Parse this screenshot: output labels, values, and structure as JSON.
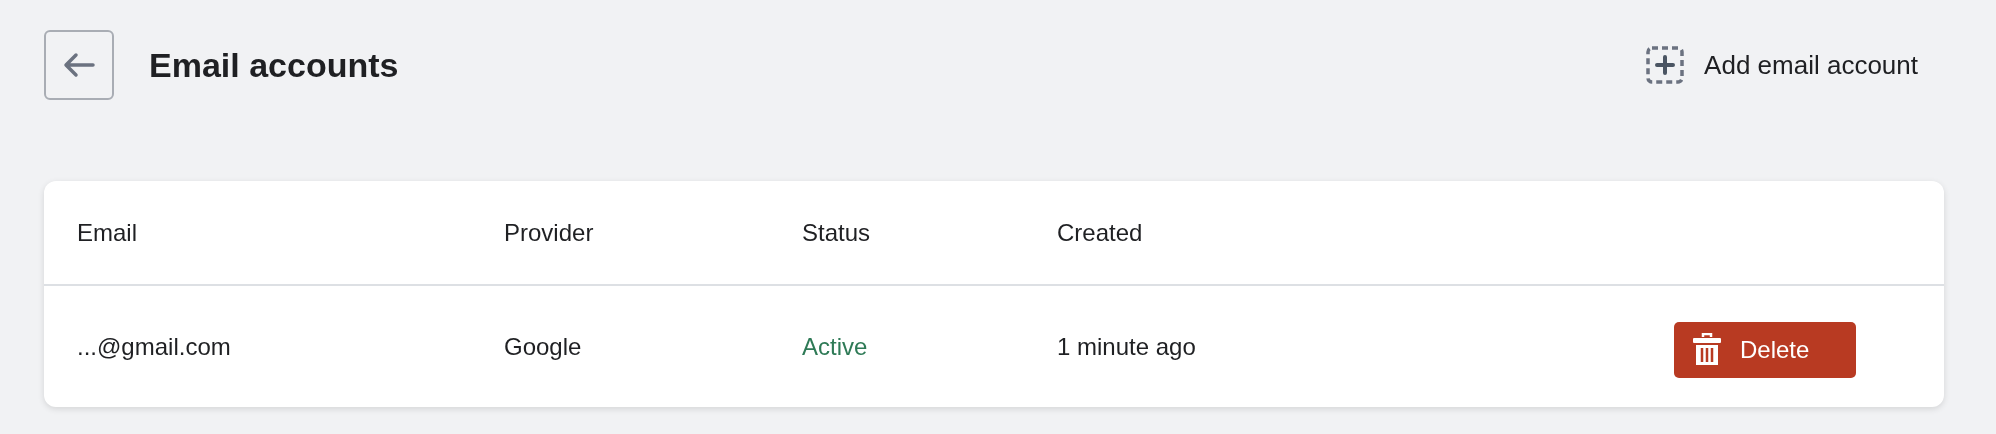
{
  "header": {
    "title": "Email accounts",
    "add_button": "Add email account"
  },
  "table": {
    "columns": [
      "Email",
      "Provider",
      "Status",
      "Created"
    ],
    "rows": [
      {
        "email": "...@gmail.com",
        "provider": "Google",
        "status": "Active",
        "color": "#2e7a56",
        "created": "1 minute ago",
        "action": "Delete"
      }
    ]
  }
}
